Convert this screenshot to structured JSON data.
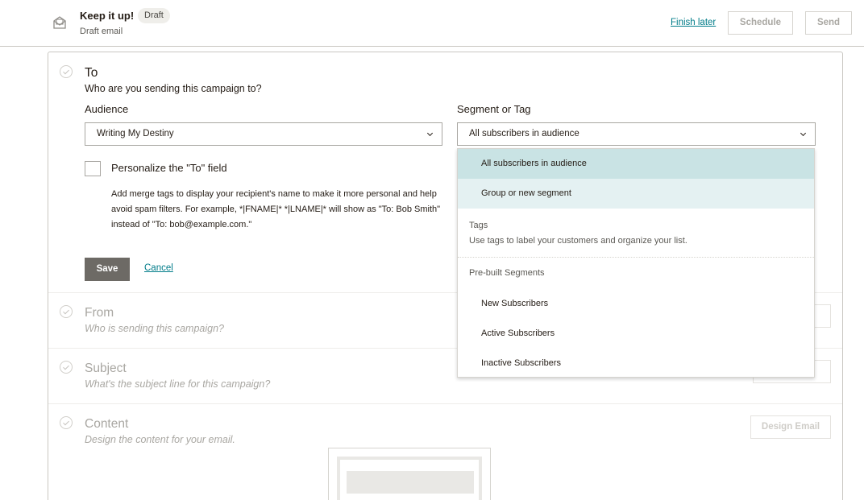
{
  "header": {
    "title": "Keep it up!",
    "badge": "Draft",
    "subtitle": "Draft email",
    "finish_later": "Finish later",
    "schedule": "Schedule",
    "send": "Send"
  },
  "to_section": {
    "title": "To",
    "subtitle": "Who are you sending this campaign to?",
    "audience_label": "Audience",
    "audience_value": "Writing My Destiny",
    "segment_label": "Segment or Tag",
    "segment_value": "All subscribers in audience",
    "personalize_label": "Personalize the \"To\" field",
    "personalize_help": "Add merge tags to display your recipient's name to make it more personal and help avoid spam filters. For example, *|FNAME|* *|LNAME|* will show as \"To: Bob Smith\" instead of \"To: bob@example.com.\"",
    "save": "Save",
    "cancel": "Cancel"
  },
  "from_section": {
    "title": "From",
    "subtitle": "Who is sending this campaign?"
  },
  "subject_section": {
    "title": "Subject",
    "subtitle": "What's the subject line for this campaign?"
  },
  "content_section": {
    "title": "Content",
    "subtitle": "Design the content for your email.",
    "design_button": "Design Email"
  },
  "dropdown": {
    "options": [
      "All subscribers in audience",
      "Group or new segment"
    ],
    "tags_heading": "Tags",
    "tags_description": "Use tags to label your customers and organize your list.",
    "prebuilt_heading": "Pre-built Segments",
    "prebuilt_items": [
      "New Subscribers",
      "Active Subscribers",
      "Inactive Subscribers"
    ]
  },
  "colors": {
    "accent_link": "#007c89",
    "selected_option": "#c9e3e4",
    "hover_option": "#e4f1f2",
    "save_button": "#6d6a65"
  }
}
